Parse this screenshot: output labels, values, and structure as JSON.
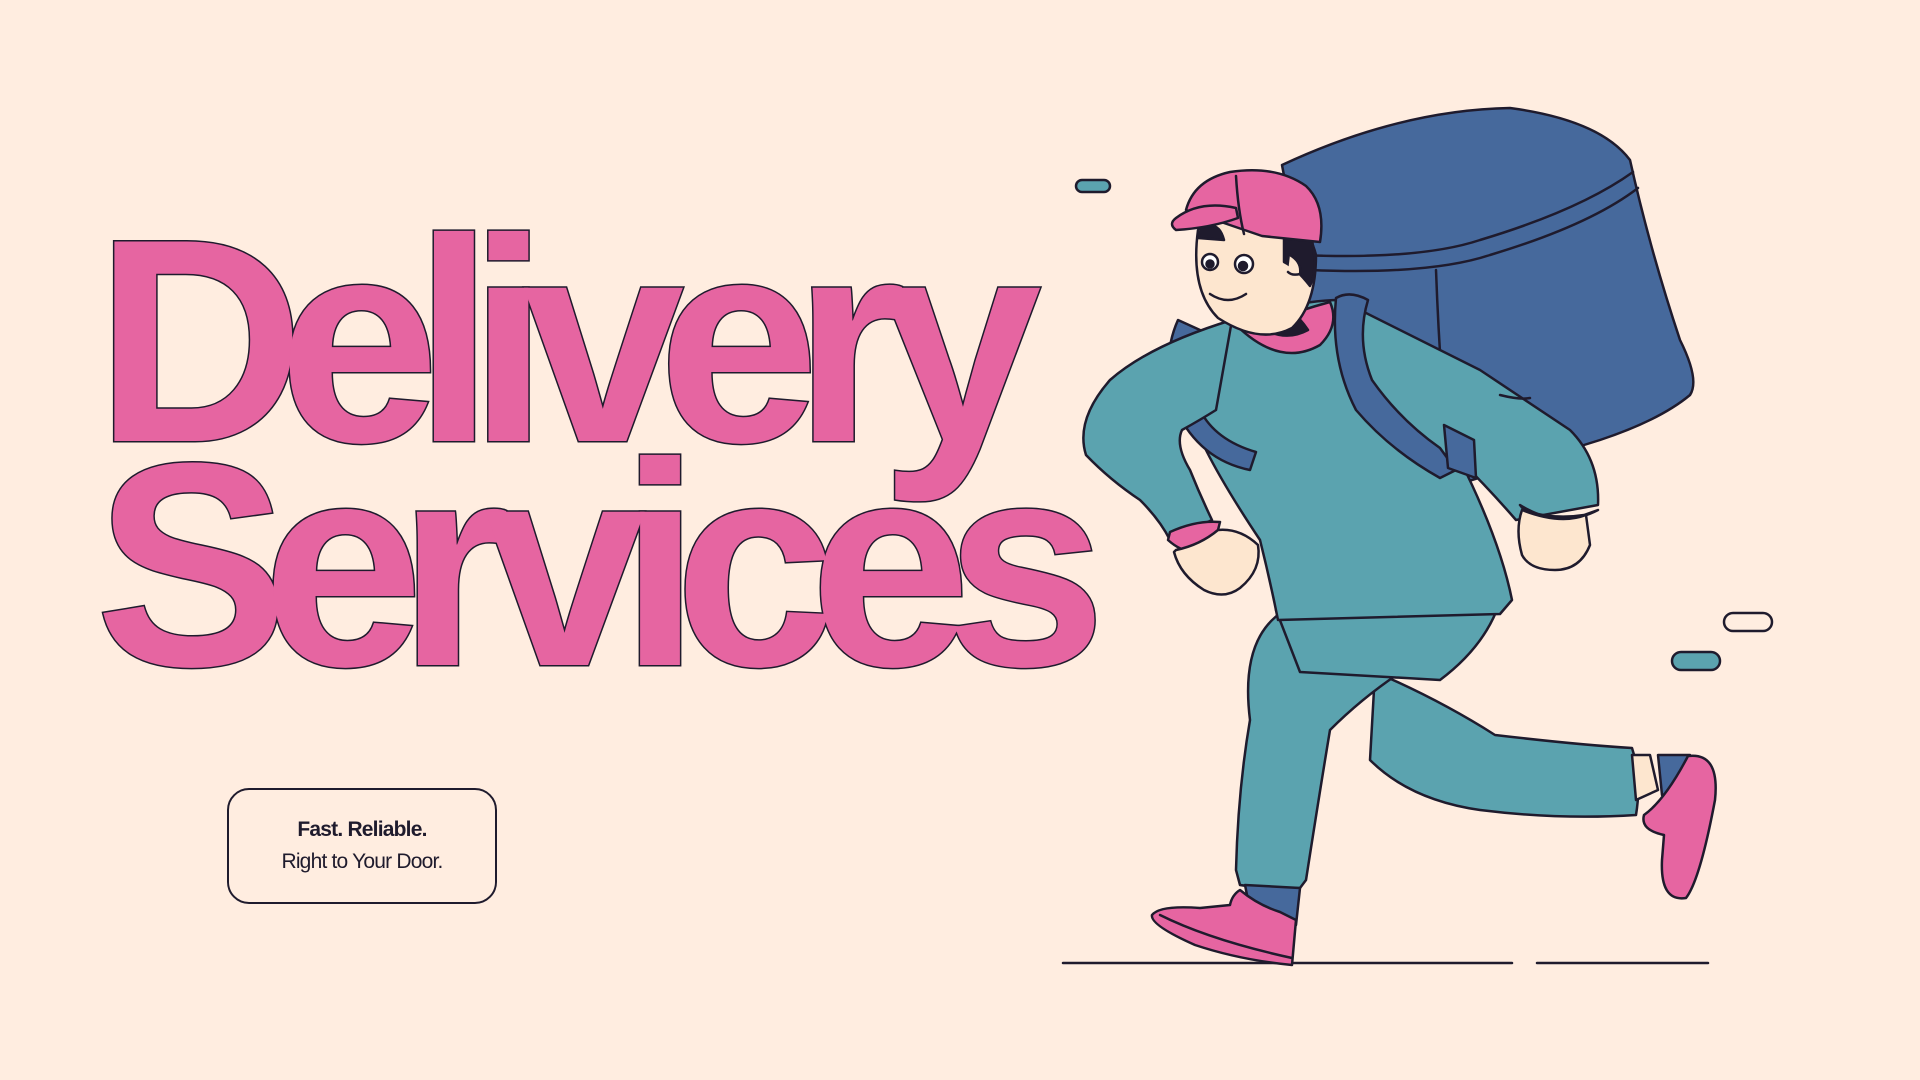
{
  "hero": {
    "title_line1": "Delivery",
    "title_line2": "Services"
  },
  "tagline": {
    "strong": "Fast. Reliable.",
    "normal": "Right to Your Door."
  },
  "colors": {
    "background": "#FFEDE0",
    "accent_pink": "#E665A1",
    "teal": "#5BA3AF",
    "navy_blue": "#46699C",
    "outline": "#1F1B2D",
    "skin": "#FDE6CF"
  },
  "illustration": {
    "subject": "running-delivery-courier",
    "icons": [
      "cap-icon",
      "backpack-icon",
      "sneaker-icon",
      "speed-dash-icon"
    ]
  }
}
